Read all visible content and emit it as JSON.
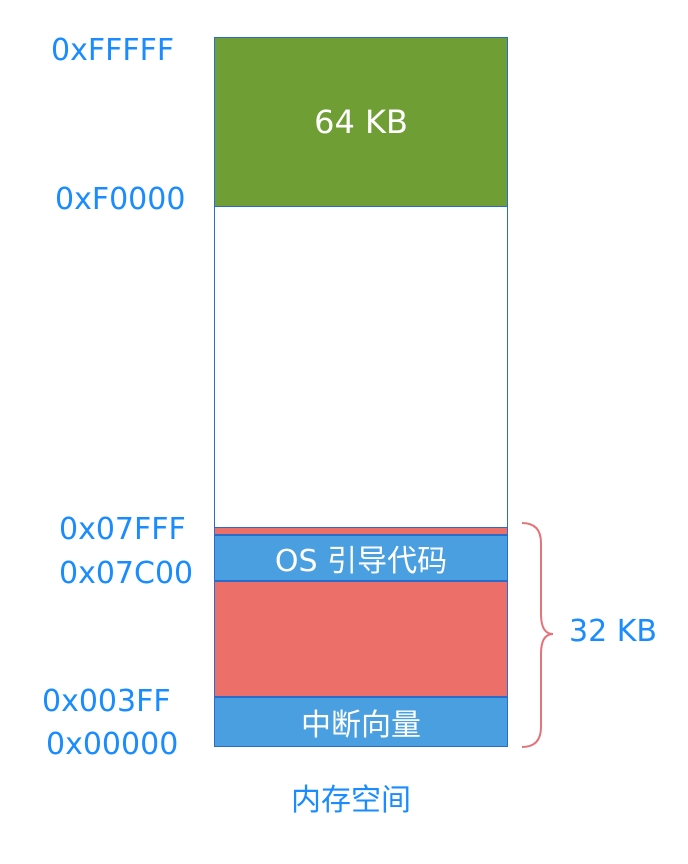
{
  "addresses": {
    "a_fffff": "0xFFFFF",
    "a_f0000": "0xF0000",
    "a_07fff": "0x07FFF",
    "a_07c00": "0x07C00",
    "a_003ff": "0x003FF",
    "a_00000": "0x00000"
  },
  "blocks": {
    "bios": {
      "label": "64 KB",
      "color": "#6f9e34"
    },
    "free": {
      "label": "",
      "color": "#ffffff"
    },
    "stack_top": {
      "label": "",
      "color": "#ec6f6a"
    },
    "boot": {
      "label": "OS 引导代码",
      "color": "#4a9fe0"
    },
    "middle": {
      "label": "",
      "color": "#ec6f6a"
    },
    "ivt": {
      "label": "中断向量",
      "color": "#4a9fe0"
    }
  },
  "brace_label": "32 KB",
  "caption": "内存空间",
  "colors": {
    "address_text": "#1a8cff",
    "outline": "#2a6cc8",
    "brace": "#e5737a"
  }
}
